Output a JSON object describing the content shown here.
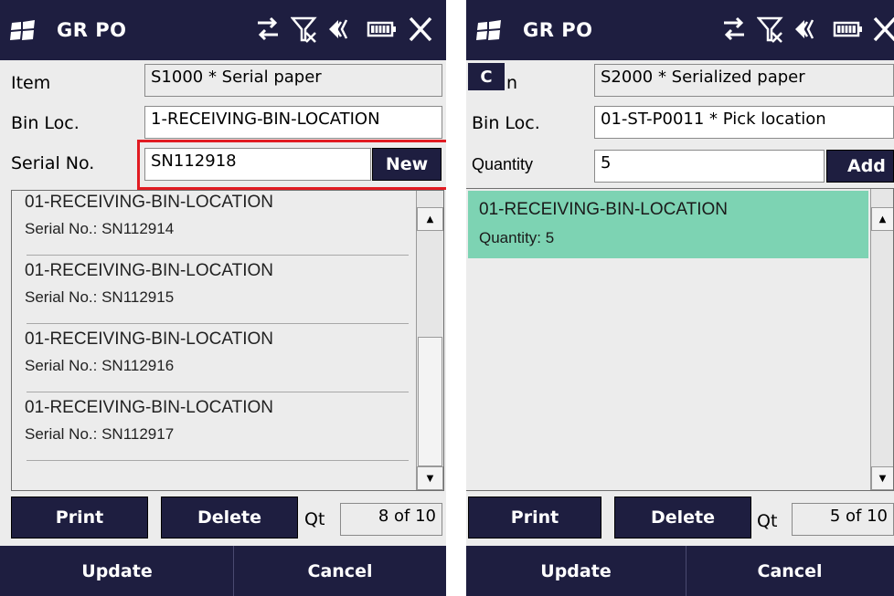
{
  "colors": {
    "titlebar": "#1e1e40",
    "highlight_border": "#e11b22",
    "selected_row": "#7dd3b3"
  },
  "left": {
    "title": "GR PO",
    "item_label": "Item",
    "item_value": "S1000 * Serial paper",
    "bin_label": "Bin Loc.",
    "bin_value": "1-RECEIVING-BIN-LOCATION",
    "serial_label": "Serial No.",
    "serial_value": "SN112918",
    "new_label": "New",
    "list": [
      {
        "bin": "01-RECEIVING-BIN-LOCATION",
        "serial": "Serial No.: SN112914"
      },
      {
        "bin": "01-RECEIVING-BIN-LOCATION",
        "serial": "Serial No.: SN112915"
      },
      {
        "bin": "01-RECEIVING-BIN-LOCATION",
        "serial": "Serial No.: SN112916"
      },
      {
        "bin": "01-RECEIVING-BIN-LOCATION",
        "serial": "Serial No.: SN112917"
      }
    ],
    "print_label": "Print",
    "delete_label": "Delete",
    "qt_label": "Qt",
    "qt_value": "8 of 10",
    "update_label": "Update",
    "cancel_label": "Cancel"
  },
  "right": {
    "title": "GR PO",
    "c_badge": "C",
    "item_label_fragment": "n",
    "item_value": "S2000 * Serialized paper",
    "bin_label": "Bin Loc.",
    "bin_value": "01-ST-P0011 * Pick location",
    "quantity_label": "Quantity",
    "quantity_value": "5",
    "add_label": "Add",
    "list": [
      {
        "bin": "01-RECEIVING-BIN-LOCATION",
        "serial": "Quantity: 5"
      }
    ],
    "print_label": "Print",
    "delete_label": "Delete",
    "qt_label": "Qt",
    "qt_value": "5 of 10",
    "update_label": "Update",
    "cancel_label": "Cancel"
  }
}
